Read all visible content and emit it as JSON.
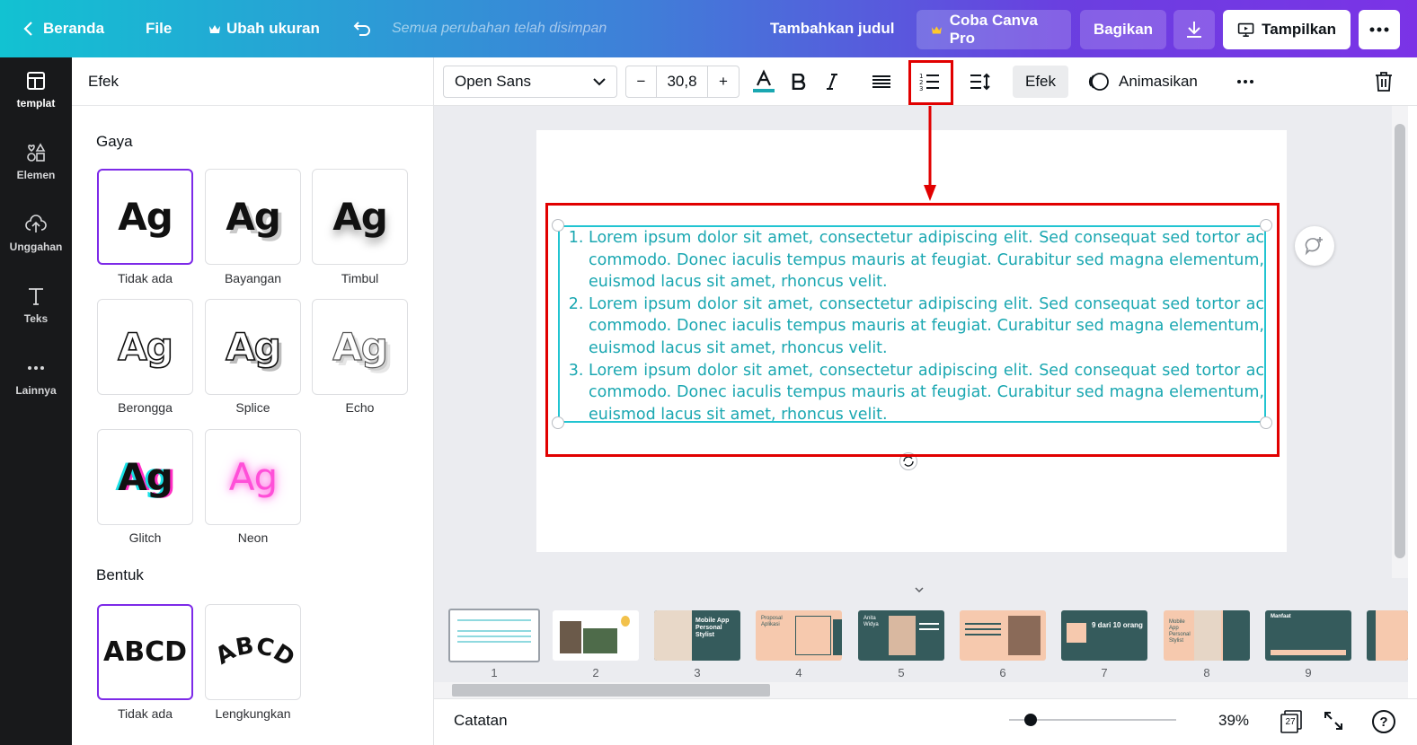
{
  "topbar": {
    "home_label": "Beranda",
    "file_label": "File",
    "resize_label": "Ubah ukuran",
    "saved_status": "Semua perubahan telah disimpan",
    "add_title_label": "Tambahkan judul",
    "pro_label": "Coba Canva Pro",
    "share_label": "Bagikan",
    "present_label": "Tampilkan"
  },
  "rail": {
    "items": [
      {
        "label": "templat",
        "icon": "template-icon"
      },
      {
        "label": "Elemen",
        "icon": "elements-icon"
      },
      {
        "label": "Unggahan",
        "icon": "upload-icon"
      },
      {
        "label": "Teks",
        "icon": "text-icon"
      },
      {
        "label": "Lainnya",
        "icon": "more-icon"
      }
    ]
  },
  "panel": {
    "title": "Efek",
    "style_section": "Gaya",
    "styles": [
      {
        "label": "Tidak ada",
        "preview": "Ag"
      },
      {
        "label": "Bayangan",
        "preview": "Ag"
      },
      {
        "label": "Timbul",
        "preview": "Ag"
      },
      {
        "label": "Berongga",
        "preview": "Ag"
      },
      {
        "label": "Splice",
        "preview": "Ag"
      },
      {
        "label": "Echo",
        "preview": "Ag"
      },
      {
        "label": "Glitch",
        "preview": "Ag"
      },
      {
        "label": "Neon",
        "preview": "Ag"
      }
    ],
    "shape_section": "Bentuk",
    "shapes": [
      {
        "label": "Tidak ada",
        "preview": "ABCD"
      },
      {
        "label": "Lengkungkan",
        "preview": "ABCD"
      }
    ]
  },
  "toolbar": {
    "font_name": "Open Sans",
    "font_size": "30,8",
    "minus": "−",
    "plus": "+",
    "effects_label": "Efek",
    "animate_label": "Animasikan"
  },
  "canvas": {
    "list_items": [
      "Lorem ipsum dolor sit amet, consectetur adipiscing elit. Sed consequat sed tortor ac commodo. Donec iaculis tempus mauris at feugiat. Curabitur sed magna elementum, euismod lacus sit amet, rhoncus velit.",
      "Lorem ipsum dolor sit amet, consectetur adipiscing elit. Sed consequat sed tortor ac commodo. Donec iaculis tempus mauris at feugiat. Curabitur sed magna elementum, euismod lacus sit amet, rhoncus velit.",
      "Lorem ipsum dolor sit amet, consectetur adipiscing elit. Sed consequat sed tortor ac commodo. Donec iaculis tempus mauris at feugiat. Curabitur sed magna elementum, euismod lacus sit amet, rhoncus velit."
    ],
    "text_color": "#1aa7b1",
    "highlight_color": "#e10000"
  },
  "thumbnails": {
    "pages": [
      {
        "num": "1",
        "title": ""
      },
      {
        "num": "2",
        "title": ""
      },
      {
        "num": "3",
        "title": "Mobile App Personal Stylist"
      },
      {
        "num": "4",
        "title": "Proposal Aplikasi"
      },
      {
        "num": "5",
        "title": "Anita Widya"
      },
      {
        "num": "6",
        "title": ""
      },
      {
        "num": "7",
        "title": "9 dari 10 orang"
      },
      {
        "num": "8",
        "title": "Mobile App Personal Stylist"
      },
      {
        "num": "9",
        "title": "Manfaat"
      }
    ]
  },
  "footer": {
    "notes_label": "Catatan",
    "zoom": "39%",
    "page_count": "27",
    "zoom_level": 0.1
  }
}
